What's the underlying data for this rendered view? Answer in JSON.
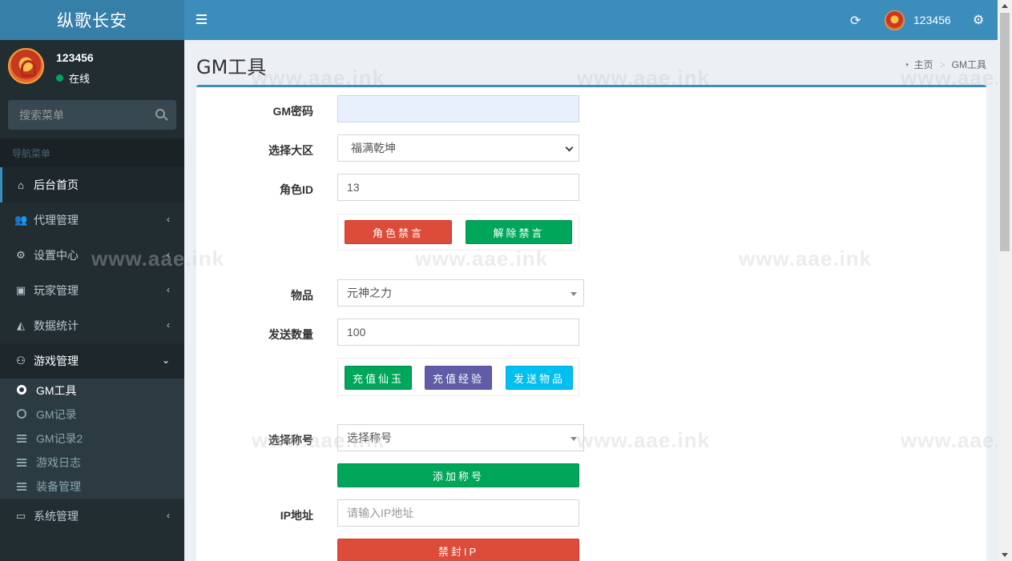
{
  "app": {
    "brand": "纵歌长安"
  },
  "user": {
    "name": "123456",
    "status": "在线"
  },
  "sidebar": {
    "search_placeholder": "搜索菜单",
    "nav_header": "导航菜单",
    "items": [
      {
        "label": "后台首页",
        "icon": "home-icon"
      },
      {
        "label": "代理管理",
        "icon": "users-icon"
      },
      {
        "label": "设置中心",
        "icon": "gears-icon"
      },
      {
        "label": "玩家管理",
        "icon": "id-card-icon"
      },
      {
        "label": "数据统计",
        "icon": "area-chart-icon"
      },
      {
        "label": "游戏管理",
        "icon": "gamepad-icon"
      },
      {
        "label": "系统管理",
        "icon": "desktop-icon"
      }
    ],
    "game_sub": [
      {
        "label": "GM工具",
        "icon": "circle-icon"
      },
      {
        "label": "GM记录",
        "icon": "circle-icon"
      },
      {
        "label": "GM记录2",
        "icon": "list-icon"
      },
      {
        "label": "游戏日志",
        "icon": "list-icon"
      },
      {
        "label": "装备管理",
        "icon": "list-icon"
      }
    ]
  },
  "header": {
    "username": "123456"
  },
  "page": {
    "title": "GM工具",
    "breadcrumb": [
      "主页",
      "GM工具"
    ]
  },
  "form": {
    "gm_password_label": "GM密码",
    "gm_password_value": "",
    "region_label": "选择大区",
    "region_value": "福满乾坤",
    "role_id_label": "角色ID",
    "role_id_value": "13",
    "mute_button": "角色禁言",
    "unmute_button": "解除禁言",
    "item_label": "物品",
    "item_value": "元神之力",
    "quantity_label": "发送数量",
    "quantity_value": "100",
    "recharge_jade_button": "充值仙玉",
    "recharge_exp_button": "充值经验",
    "send_item_button": "发送物品",
    "title_label": "选择称号",
    "title_value": "选择称号",
    "add_title_button": "添加称号",
    "ip_label": "IP地址",
    "ip_placeholder": "请输入IP地址",
    "ban_ip_button": "禁封IP"
  },
  "watermark": "www.aae.ink",
  "colors": {
    "primary": "#3c8dbc",
    "sidebar_bg": "#222d32",
    "danger": "#dd4b39",
    "success": "#00a65a",
    "purple": "#605ca8",
    "info": "#00c0ef"
  }
}
